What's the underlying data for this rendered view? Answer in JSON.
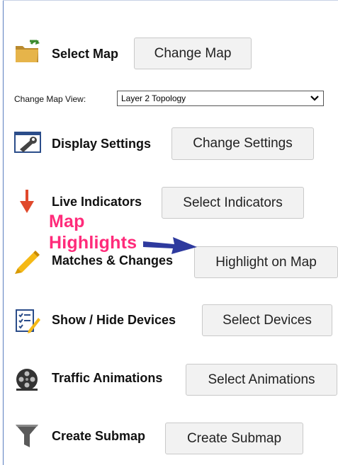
{
  "rows": {
    "select_map": {
      "label": "Select Map",
      "button": "Change Map"
    },
    "change_map_view": {
      "label": "Change Map View:",
      "selected": "Layer 2 Topology"
    },
    "display_settings": {
      "label": "Display Settings",
      "button": "Change Settings"
    },
    "live_indicators": {
      "label": "Live Indicators",
      "button": "Select Indicators"
    },
    "highlight": {
      "label": "Matches & Changes",
      "button": "Highlight on Map"
    },
    "show_hide": {
      "label": "Show / Hide Devices",
      "button": "Select Devices"
    },
    "traffic": {
      "label": "Traffic Animations",
      "button": "Select Animations"
    },
    "submap": {
      "label": "Create Submap",
      "button": "Create Submap"
    }
  },
  "annotation": {
    "line1": "Map",
    "line2": "Highlights"
  },
  "icons": {
    "select_map": "folder-icon",
    "display_settings": "settings-icon",
    "live_indicators": "down-arrow-icon",
    "highlight": "highlighter-icon",
    "show_hide": "checklist-icon",
    "traffic": "film-reel-icon",
    "submap": "funnel-icon"
  },
  "colors": {
    "annotation_text": "#ff2b7a",
    "annotation_arrow": "#2e3a9e",
    "indicator_arrow": "#e0492c",
    "highlighter": "#f5b916"
  }
}
